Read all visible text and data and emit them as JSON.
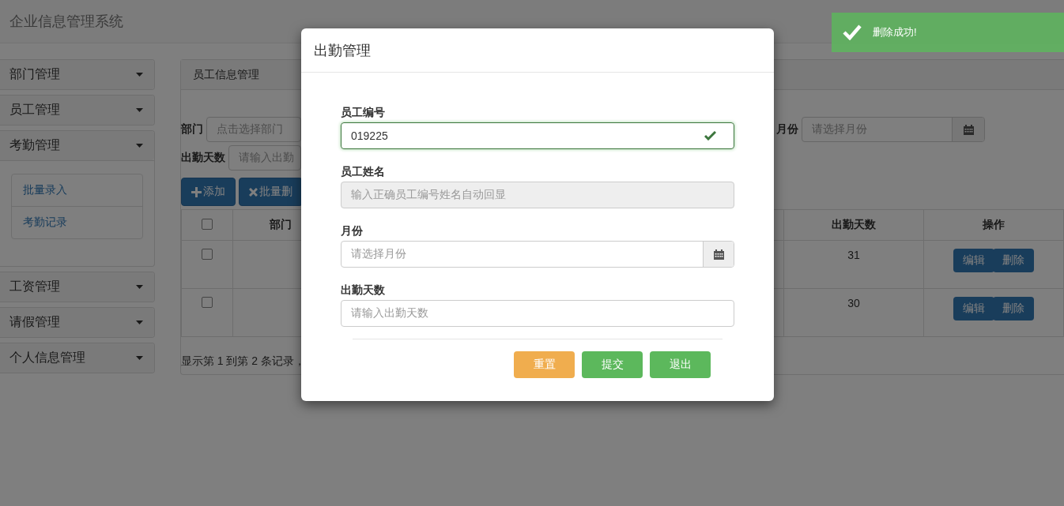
{
  "header": {
    "title": "企业信息管理系统"
  },
  "sidebar": {
    "items": [
      {
        "label": "部门管理"
      },
      {
        "label": "员工管理"
      },
      {
        "label": "考勤管理",
        "children": [
          {
            "label": "批量录入"
          },
          {
            "label": "考勤记录"
          }
        ]
      },
      {
        "label": "工资管理"
      },
      {
        "label": "请假管理"
      },
      {
        "label": "个人信息管理"
      }
    ]
  },
  "main": {
    "tabs": [
      {
        "label": "员工信息管理",
        "selected": true
      }
    ],
    "filters": [
      {
        "label": "部门",
        "placeholder": "点击选择部门",
        "kind": "text"
      },
      {
        "label": "月份",
        "placeholder": "请选择月份",
        "kind": "date"
      },
      {
        "label": "出勤天数",
        "placeholder": "请输入出勤",
        "kind": "text"
      }
    ],
    "buttons": [
      {
        "label": "添加",
        "kind": "add"
      },
      {
        "label": "批量删",
        "kind": "delete"
      }
    ],
    "table": {
      "select_all": {
        "checked": false
      },
      "columns": [
        "部门",
        "出勤天数",
        "操作"
      ],
      "rows": [
        {
          "checked": false,
          "days": "31",
          "actions": [
            "编辑",
            "删除"
          ]
        },
        {
          "checked": false,
          "days": "30",
          "actions": [
            "编辑",
            "删除"
          ]
        }
      ]
    },
    "footer": "显示第 1 到第 2 条记录，"
  },
  "modal": {
    "title": "出勤管理",
    "fields": [
      {
        "label": "员工编号",
        "value": "019225",
        "kind": "text",
        "valid": true,
        "disabled": false
      },
      {
        "label": "员工姓名",
        "placeholder": "输入正确员工编号姓名自动回显",
        "kind": "text",
        "valid": false,
        "disabled": true
      },
      {
        "label": "月份",
        "placeholder": "请选择月份",
        "kind": "date",
        "valid": false,
        "disabled": false
      },
      {
        "label": "出勤天数",
        "placeholder": "请输入出勤天数",
        "kind": "text",
        "valid": false,
        "disabled": false
      }
    ],
    "buttons": [
      {
        "label": "重置",
        "kind": "warning"
      },
      {
        "label": "提交",
        "kind": "success"
      },
      {
        "label": "退出",
        "kind": "success"
      }
    ]
  },
  "toast": {
    "message": "删除成功!"
  }
}
